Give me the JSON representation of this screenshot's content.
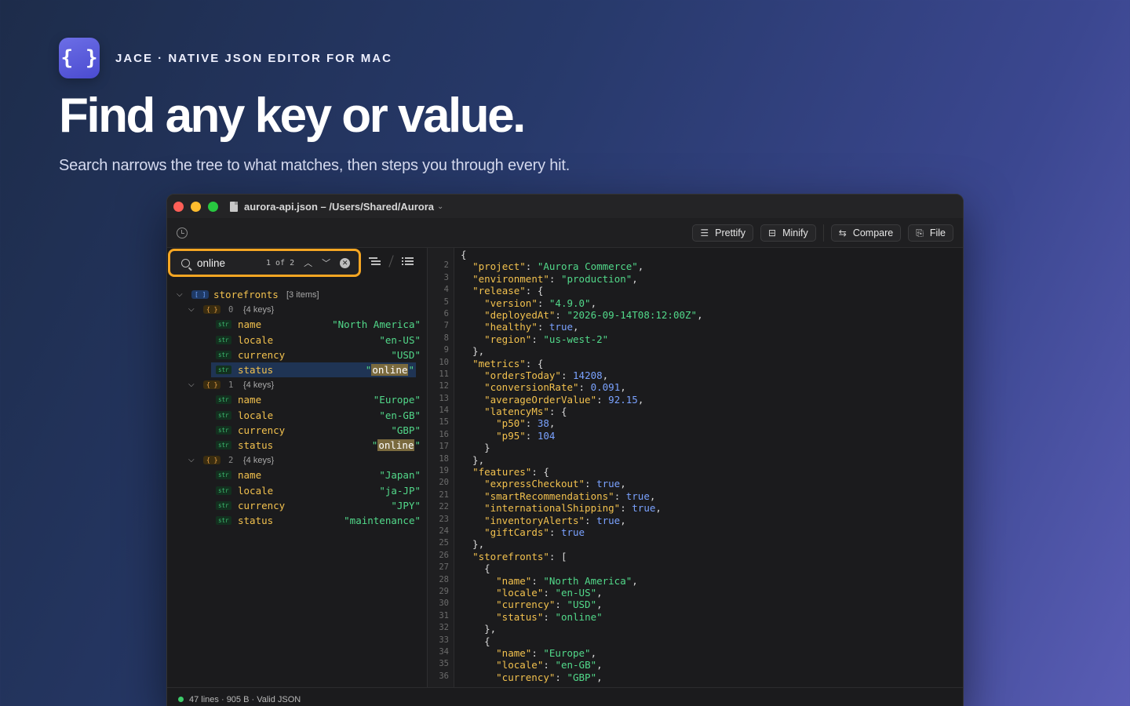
{
  "brand": {
    "icon_glyph": "{ }",
    "tagline": "JACE · NATIVE JSON EDITOR FOR MAC"
  },
  "headline": "Find any key or value.",
  "subline": "Search narrows the tree to what matches, then steps you through every hit.",
  "window": {
    "title": "aurora-api.json – /Users/Shared/Aurora",
    "toolbar": {
      "prettify": "Prettify",
      "minify": "Minify",
      "compare": "Compare",
      "file": "File"
    },
    "search": {
      "value": "online",
      "match_count": "1 of 2"
    },
    "status": "47 lines · 905 B · Valid JSON"
  },
  "tree": {
    "root": {
      "key": "storefronts",
      "meta": "[3 items]"
    },
    "objects": [
      {
        "index": "0",
        "meta": "{4 keys}",
        "rows": [
          {
            "key": "name",
            "value": "\"North America\""
          },
          {
            "key": "locale",
            "value": "\"en-US\""
          },
          {
            "key": "currency",
            "value": "\"USD\""
          },
          {
            "key": "status",
            "value": "online"
          }
        ]
      },
      {
        "index": "1",
        "meta": "{4 keys}",
        "rows": [
          {
            "key": "name",
            "value": "\"Europe\""
          },
          {
            "key": "locale",
            "value": "\"en-GB\""
          },
          {
            "key": "currency",
            "value": "\"GBP\""
          },
          {
            "key": "status",
            "value": "online"
          }
        ]
      },
      {
        "index": "2",
        "meta": "{4 keys}",
        "rows": [
          {
            "key": "name",
            "value": "\"Japan\""
          },
          {
            "key": "locale",
            "value": "\"ja-JP\""
          },
          {
            "key": "currency",
            "value": "\"JPY\""
          },
          {
            "key": "status",
            "value": "\"maintenance\""
          }
        ]
      }
    ]
  },
  "code_lines": [
    "{",
    "  \"project\": \"Aurora Commerce\",",
    "  \"environment\": \"production\",",
    "  \"release\": {",
    "    \"version\": \"4.9.0\",",
    "    \"deployedAt\": \"2026-09-14T08:12:00Z\",",
    "    \"healthy\": true,",
    "    \"region\": \"us-west-2\"",
    "  },",
    "  \"metrics\": {",
    "    \"ordersToday\": 14208,",
    "    \"conversionRate\": 0.091,",
    "    \"averageOrderValue\": 92.15,",
    "    \"latencyMs\": {",
    "      \"p50\": 38,",
    "      \"p95\": 104",
    "    }",
    "  },",
    "  \"features\": {",
    "    \"expressCheckout\": true,",
    "    \"smartRecommendations\": true,",
    "    \"internationalShipping\": true,",
    "    \"inventoryAlerts\": true,",
    "    \"giftCards\": true",
    "  },",
    "  \"storefronts\": [",
    "    {",
    "      \"name\": \"North America\",",
    "      \"locale\": \"en-US\",",
    "      \"currency\": \"USD\",",
    "      \"status\": \"online\"",
    "    },",
    "    {",
    "      \"name\": \"Europe\",",
    "      \"locale\": \"en-GB\",",
    "      \"currency\": \"GBP\","
  ],
  "gutter_numbers": [
    "2",
    "3",
    "4",
    "5",
    "6",
    "7",
    "8",
    "9",
    "10",
    "11",
    "12",
    "13",
    "14",
    "15",
    "16",
    "17",
    "18",
    "19",
    "20",
    "21",
    "22",
    "23",
    "24",
    "25",
    "26",
    "27",
    "28",
    "29",
    "30",
    "31",
    "32",
    "33",
    "34",
    "35",
    "36"
  ]
}
